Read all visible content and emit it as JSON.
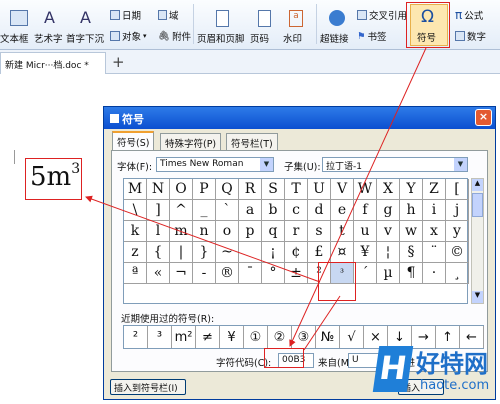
{
  "ribbon": {
    "textbox": "文本框",
    "wordart": "艺术字",
    "drop_cap": "首字下沉",
    "date": "日期",
    "field": "域",
    "object": "对象",
    "attachment": "附件",
    "header_footer": "页眉和页脚",
    "page_number": "页码",
    "watermark": "水印",
    "hyperlink": "超链接",
    "cross_ref": "交叉引用",
    "bookmark": "书签",
    "symbol": "符号",
    "formula": "公式",
    "number": "数字"
  },
  "doc_tab": "新建 Micr···档.doc *",
  "doc_text": {
    "base": "5m",
    "sup": "3"
  },
  "dialog": {
    "title": "符号",
    "tabs": [
      "符号(S)",
      "特殊字符(P)",
      "符号栏(T)"
    ],
    "font_label": "字体(F):",
    "font_value": "Times New Roman",
    "subset_label": "子集(U):",
    "subset_value": "拉丁语-1",
    "symbols": [
      "M",
      "N",
      "O",
      "P",
      "Q",
      "R",
      "S",
      "T",
      "U",
      "V",
      "W",
      "X",
      "Y",
      "Z",
      "[",
      "\\",
      "]",
      "^",
      "_",
      "`",
      "a",
      "b",
      "c",
      "d",
      "e",
      "f",
      "g",
      "h",
      "i",
      "j",
      "k",
      "l",
      "m",
      "n",
      "o",
      "p",
      "q",
      "r",
      "s",
      "t",
      "u",
      "v",
      "w",
      "x",
      "y",
      "z",
      "{",
      "|",
      "}",
      "~",
      "",
      "¡",
      "¢",
      "£",
      "¤",
      "¥",
      "¦",
      "§",
      "¨",
      "©",
      "ª",
      "«",
      "¬",
      "-",
      "®",
      "¯",
      "°",
      "±",
      "²",
      "³",
      "´",
      "µ",
      "¶",
      "·",
      "¸"
    ],
    "recent_label": "近期使用过的符号(R):",
    "recent": [
      "²",
      "³",
      "m²",
      "≠",
      "¥",
      "①",
      "②",
      "③",
      "№",
      "√",
      "×",
      "↓",
      "→",
      "↑",
      "←"
    ],
    "code_label": "字符代码(C):",
    "code_value": "00B3",
    "from_label": "来自(M):",
    "from_value": "U",
    "extra": "六进",
    "insert_bar_button": "插入到符号栏(I)",
    "ok": "插入"
  },
  "watermark": {
    "brand": "好特网",
    "url": "haote.com"
  },
  "colors": {
    "accent": "#d22",
    "title_blue": "#0b4fd0"
  }
}
